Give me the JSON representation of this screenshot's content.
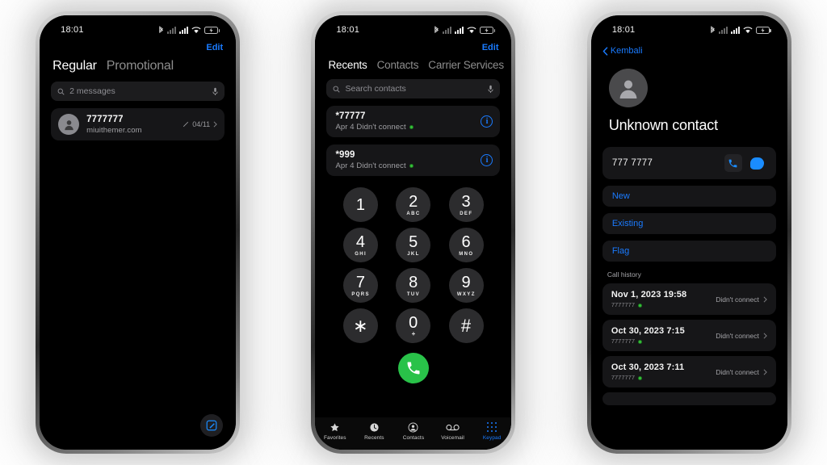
{
  "status_bar": {
    "time": "18:01",
    "icons": [
      "bluetooth-icon",
      "signal-bars-dim-icon",
      "signal-bars-icon",
      "wifi-icon",
      "battery-charging-icon"
    ]
  },
  "colors": {
    "accent_blue": "#1a7bff",
    "call_green": "#29c249",
    "status_green": "#37c33a",
    "card_bg": "#161618",
    "screen_bg": "#000000",
    "page_bg": "#ffffff"
  },
  "phone1_messages": {
    "edit_label": "Edit",
    "tabs": [
      {
        "label": "Regular",
        "active": true
      },
      {
        "label": "Promotional",
        "active": false
      }
    ],
    "search": {
      "placeholder": "2 messages",
      "mic_icon": "microphone-icon"
    },
    "threads": [
      {
        "title": "7777777",
        "subtitle": "miuithemer.com",
        "date": "04/11",
        "pencil_icon": "pencil-icon",
        "chevron_icon": "chevron-right-icon"
      }
    ],
    "compose_icon": "compose-message-icon"
  },
  "phone2_phone": {
    "edit_label": "Edit",
    "tabs": [
      {
        "label": "Recents",
        "active": true
      },
      {
        "label": "Contacts",
        "active": false
      },
      {
        "label": "Carrier Services",
        "active": false
      }
    ],
    "search": {
      "placeholder": "Search contacts",
      "mic_icon": "microphone-icon"
    },
    "recents": [
      {
        "number": "*77777",
        "detail": "Apr 4 Didn't connect",
        "info_label": "i"
      },
      {
        "number": "*999",
        "detail": "Apr 4 Didn't connect",
        "info_label": "i"
      }
    ],
    "dialpad": [
      {
        "digit": "1",
        "letters": ""
      },
      {
        "digit": "2",
        "letters": "ABC"
      },
      {
        "digit": "3",
        "letters": "DEF"
      },
      {
        "digit": "4",
        "letters": "GHI"
      },
      {
        "digit": "5",
        "letters": "JKL"
      },
      {
        "digit": "6",
        "letters": "MNO"
      },
      {
        "digit": "7",
        "letters": "PQRS"
      },
      {
        "digit": "8",
        "letters": "TUV"
      },
      {
        "digit": "9",
        "letters": "WXYZ"
      },
      {
        "digit": "∗",
        "letters": ""
      },
      {
        "digit": "0",
        "letters": "+"
      },
      {
        "digit": "#",
        "letters": ""
      }
    ],
    "call_button_icon": "phone-handset-icon",
    "tabbar": [
      {
        "label": "Favorites",
        "icon": "star-icon",
        "active": false
      },
      {
        "label": "Recents",
        "icon": "clock-icon",
        "active": false
      },
      {
        "label": "Contacts",
        "icon": "person-circle-icon",
        "active": false
      },
      {
        "label": "Voicemail",
        "icon": "voicemail-icon",
        "active": false
      },
      {
        "label": "Keypad",
        "icon": "keypad-grid-icon",
        "active": true
      }
    ]
  },
  "phone3_contact": {
    "back_label": "Kembali",
    "back_icon": "chevron-left-icon",
    "avatar_icon": "person-icon",
    "contact_name": "Unknown contact",
    "number": "777 7777",
    "call_icon": "phone-handset-icon",
    "message_icon": "message-bubble-icon",
    "actions": [
      {
        "label": "New"
      },
      {
        "label": "Existing"
      },
      {
        "label": "Flag"
      }
    ],
    "history_label": "Call history",
    "history": [
      {
        "date": "Nov 1, 2023 19:58",
        "number": "7777777",
        "status": "Didn't connect"
      },
      {
        "date": "Oct 30, 2023 7:15",
        "number": "7777777",
        "status": "Didn't connect"
      },
      {
        "date": "Oct 30, 2023 7:11",
        "number": "7777777",
        "status": "Didn't connect"
      }
    ]
  }
}
